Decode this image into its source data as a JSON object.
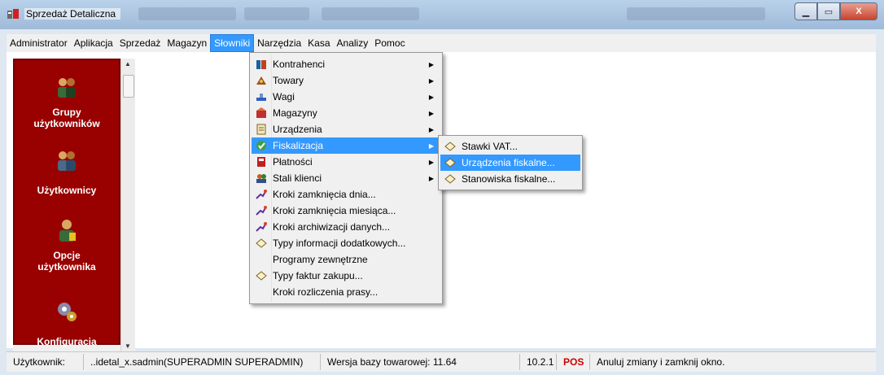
{
  "window": {
    "title": "Sprzedaż Detaliczna"
  },
  "titlebar": {
    "minimize": "▁",
    "maximize": "▭",
    "close": "X"
  },
  "menubar": {
    "items": [
      "Administrator",
      "Aplikacja",
      "Sprzedaż",
      "Magazyn",
      "Słowniki",
      "Narzędzia",
      "Kasa",
      "Analizy",
      "Pomoc"
    ],
    "active": "Słowniki"
  },
  "sidebar": {
    "items": [
      {
        "label_line1": "Grupy",
        "label_line2": "użytkowników",
        "icon": "users-group-icon"
      },
      {
        "label_line1": "Użytkownicy",
        "label_line2": "",
        "icon": "users-icon"
      },
      {
        "label_line1": "Opcje",
        "label_line2": "użytkownika",
        "icon": "user-options-icon"
      },
      {
        "label_line1": "Konfiguracja",
        "label_line2": "",
        "icon": "configuration-icon"
      }
    ]
  },
  "menu_slowniki": {
    "items": [
      {
        "label": "Kontrahenci",
        "icon": "contractors-icon",
        "submenu": true
      },
      {
        "label": "Towary",
        "icon": "goods-icon",
        "submenu": true
      },
      {
        "label": "Wagi",
        "icon": "scale-icon",
        "submenu": true
      },
      {
        "label": "Magazyny",
        "icon": "warehouse-icon",
        "submenu": true
      },
      {
        "label": "Urządzenia",
        "icon": "devices-icon",
        "submenu": true
      },
      {
        "label": "Fiskalizacja",
        "icon": "fiscal-icon",
        "submenu": true,
        "highlighted": true
      },
      {
        "label": "Płatności",
        "icon": "payments-icon",
        "submenu": true
      },
      {
        "label": "Stali klienci",
        "icon": "regular-clients-icon",
        "submenu": true
      },
      {
        "label": "Kroki zamknięcia dnia...",
        "icon": "steps-icon",
        "submenu": false
      },
      {
        "label": "Kroki zamknięcia miesiąca...",
        "icon": "steps-icon",
        "submenu": false
      },
      {
        "label": "Kroki archiwizacji danych...",
        "icon": "steps-icon",
        "submenu": false
      },
      {
        "label": "Typy informacji dodatkowych...",
        "icon": "diamond-icon",
        "submenu": false
      },
      {
        "label": "Programy zewnętrzne",
        "icon": "",
        "submenu": false
      },
      {
        "label": "Typy faktur zakupu...",
        "icon": "diamond-icon",
        "submenu": false
      },
      {
        "label": "Kroki rozliczenia prasy...",
        "icon": "",
        "submenu": false
      }
    ]
  },
  "menu_fiskalizacja": {
    "items": [
      {
        "label": "Stawki VAT...",
        "icon": "diamond-icon"
      },
      {
        "label": "Urządzenia fiskalne...",
        "icon": "diamond-icon",
        "highlighted": true
      },
      {
        "label": "Stanowiska fiskalne...",
        "icon": "diamond-icon"
      }
    ]
  },
  "statusbar": {
    "user_label": "Użytkownik:",
    "user_value": "..idetal_x.sadmin(SUPERADMIN SUPERADMIN)",
    "db_version": "Wersja bazy towarowej: 11.64",
    "app_version": "10.2.1",
    "mode": "POS",
    "hint": "Anuluj zmiany i zamknij okno."
  },
  "colors": {
    "sidebar": "#990000",
    "highlight": "#3399ff",
    "pos": "#cc0000"
  }
}
